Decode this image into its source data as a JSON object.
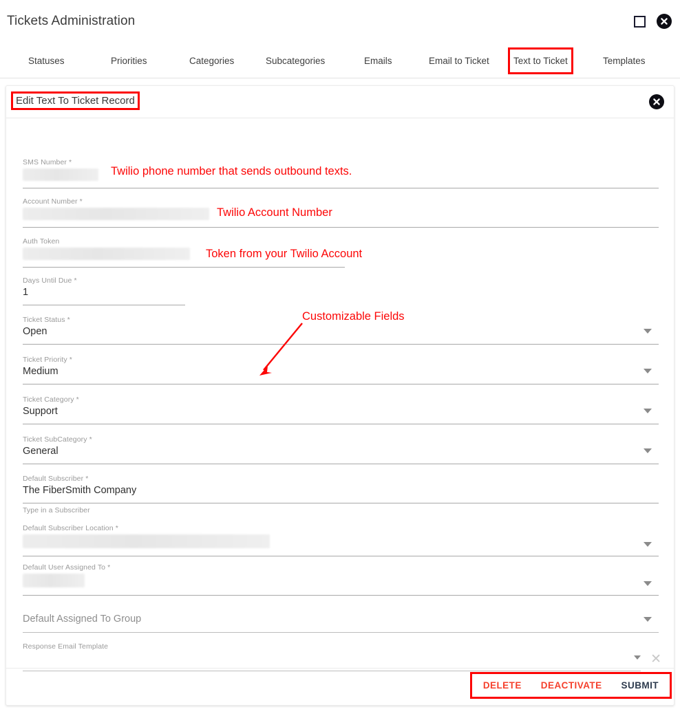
{
  "window": {
    "title": "Tickets Administration",
    "restore_icon": "square-icon",
    "close_icon": "close-circle-icon"
  },
  "tabs": [
    {
      "label": "Statuses",
      "active": false,
      "highlighted": false
    },
    {
      "label": "Priorities",
      "active": false,
      "highlighted": false
    },
    {
      "label": "Categories",
      "active": false,
      "highlighted": false
    },
    {
      "label": "Subcategories",
      "active": false,
      "highlighted": false
    },
    {
      "label": "Emails",
      "active": false,
      "highlighted": false
    },
    {
      "label": "Email to Ticket",
      "active": false,
      "highlighted": false
    },
    {
      "label": "Text to Ticket",
      "active": true,
      "highlighted": true
    },
    {
      "label": "Templates",
      "active": false,
      "highlighted": false
    }
  ],
  "form": {
    "title": "Edit Text To Ticket Record",
    "close_icon": "close-circle-icon",
    "fields": [
      {
        "label": "SMS Number *",
        "value": "",
        "redacted": true,
        "type": "text"
      },
      {
        "label": "Account Number *",
        "value": "",
        "redacted": true,
        "type": "text"
      },
      {
        "label": "Auth Token",
        "value": "",
        "redacted": true,
        "type": "text"
      },
      {
        "label": "Days Until Due *",
        "value": "1",
        "redacted": false,
        "type": "text"
      },
      {
        "label": "Ticket Status *",
        "value": "Open",
        "redacted": false,
        "type": "select"
      },
      {
        "label": "Ticket Priority *",
        "value": "Medium",
        "redacted": false,
        "type": "select"
      },
      {
        "label": "Ticket Category *",
        "value": "Support",
        "redacted": false,
        "type": "select"
      },
      {
        "label": "Ticket SubCategory *",
        "value": "General",
        "redacted": false,
        "type": "select"
      },
      {
        "label": "Default Subscriber *",
        "value": "The FiberSmith Company",
        "redacted": false,
        "type": "text"
      },
      {
        "label": "",
        "value": "Type in a Subscriber",
        "redacted": false,
        "type": "hint"
      },
      {
        "label": "Default Subscriber Location *",
        "value": "",
        "redacted": true,
        "type": "select"
      },
      {
        "label": "Default User Assigned To *",
        "value": "",
        "redacted": true,
        "type": "select"
      },
      {
        "label": "",
        "value": "Default Assigned To Group",
        "redacted": false,
        "type": "select-placeholder"
      },
      {
        "label": "Response Email Template",
        "value": "",
        "redacted": false,
        "type": "select-clearable"
      }
    ],
    "actions": [
      {
        "label": "DELETE",
        "style": "danger"
      },
      {
        "label": "DEACTIVATE",
        "style": "danger"
      },
      {
        "label": "SUBMIT",
        "style": "primary"
      }
    ]
  },
  "annotations": [
    {
      "text": "Twilio phone number that sends outbound texts."
    },
    {
      "text": "Twilio Account Number"
    },
    {
      "text": "Token from your Twilio Account"
    },
    {
      "text": "Customizable Fields"
    }
  ],
  "colors": {
    "annotation_red": "#fc0606",
    "highlight_red": "#fc0404",
    "danger_action": "#f5402c",
    "primary_action": "#2e3b4e",
    "label_gray": "#9a9a9a",
    "value_dark": "#2f2f2f"
  }
}
